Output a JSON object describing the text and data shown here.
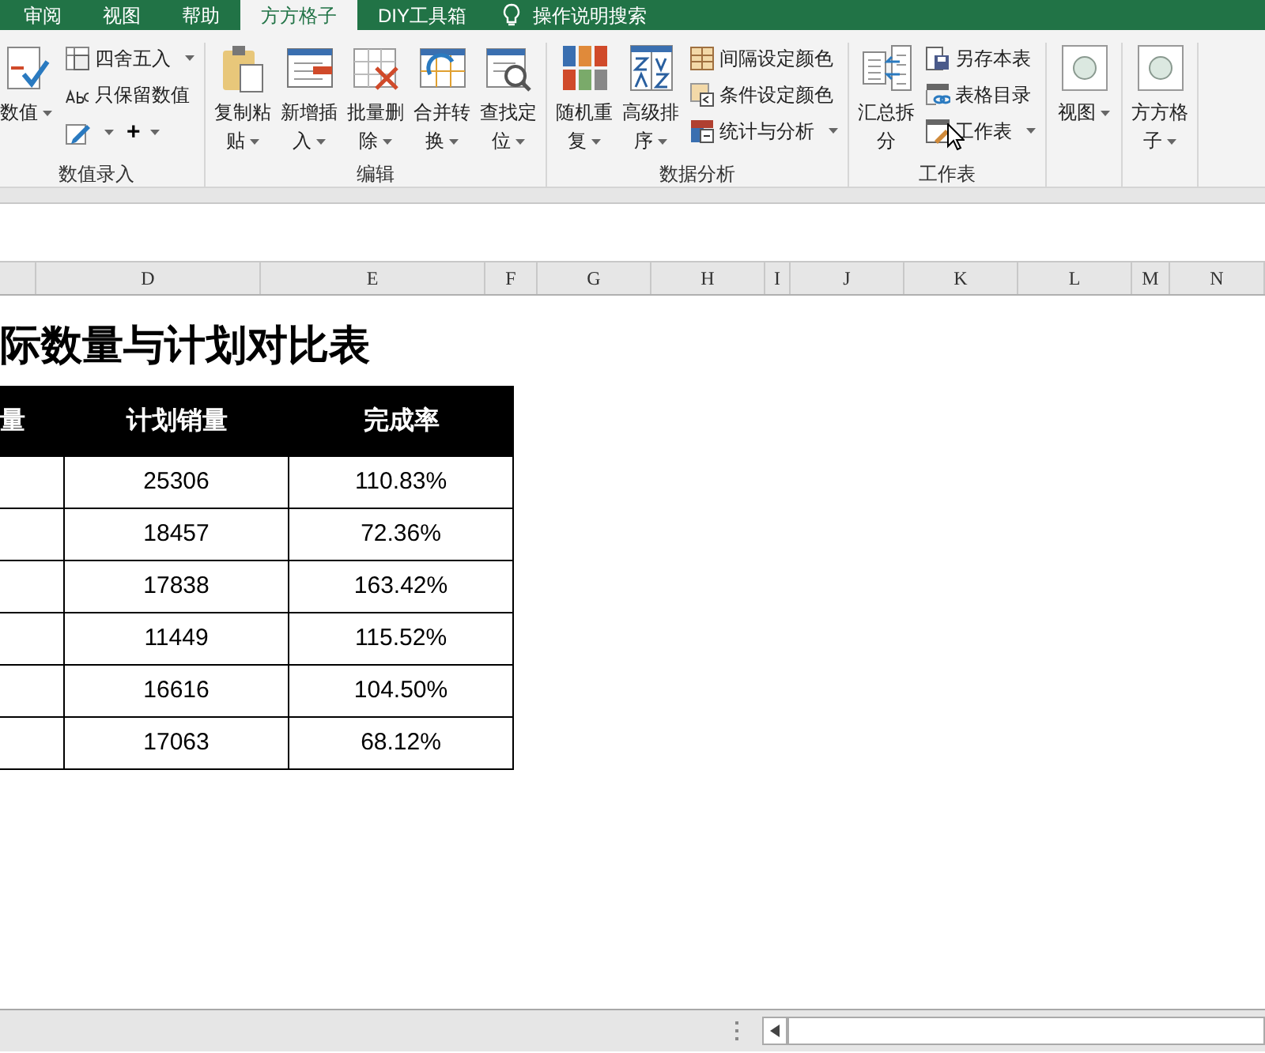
{
  "tabs": [
    {
      "label": "审阅",
      "selected": false
    },
    {
      "label": "视图",
      "selected": false
    },
    {
      "label": "帮助",
      "selected": false
    },
    {
      "label": "方方格子",
      "selected": true
    },
    {
      "label": "DIY工具箱",
      "selected": false
    }
  ],
  "search": {
    "label": "操作说明搜索"
  },
  "ribbon": {
    "groups": [
      {
        "label": "数值录入",
        "items": [
          {
            "kind": "large",
            "label": "数值",
            "dropdown": true
          },
          {
            "kind": "stack",
            "items": [
              {
                "label": "四舍五入",
                "dropdown": true
              },
              {
                "label": "只保留数值",
                "dropdown": false
              },
              {
                "dropdown": true,
                "extra": "+"
              }
            ]
          }
        ]
      },
      {
        "label": "编辑",
        "items": [
          {
            "kind": "large",
            "label": "复制粘贴",
            "dropdown": true
          },
          {
            "kind": "large",
            "label": "新增插入",
            "dropdown": true
          },
          {
            "kind": "large",
            "label": "批量删除",
            "dropdown": true
          },
          {
            "kind": "large",
            "label": "合并转换",
            "dropdown": true
          },
          {
            "kind": "large",
            "label": "查找定位",
            "dropdown": true
          }
        ]
      },
      {
        "label": "数据分析",
        "items": [
          {
            "kind": "large",
            "label": "随机重复",
            "dropdown": true
          },
          {
            "kind": "large",
            "label": "高级排序",
            "dropdown": true
          },
          {
            "kind": "stack",
            "items": [
              {
                "label": "间隔设定颜色",
                "dropdown": false
              },
              {
                "label": "条件设定颜色",
                "dropdown": false
              },
              {
                "label": "统计与分析",
                "dropdown": true
              }
            ]
          }
        ]
      },
      {
        "label": "工作表",
        "items": [
          {
            "kind": "large",
            "label": "汇总拆分",
            "dropdown": false
          },
          {
            "kind": "stack",
            "items": [
              {
                "label": "另存本表",
                "dropdown": false
              },
              {
                "label": "表格目录",
                "dropdown": false
              },
              {
                "label": "工作表",
                "dropdown": true
              }
            ]
          }
        ]
      },
      {
        "items": [
          {
            "kind": "large",
            "label": "视图",
            "dropdown": true
          }
        ]
      },
      {
        "items": [
          {
            "kind": "large",
            "label": "方方格子",
            "dropdown": true
          }
        ]
      }
    ]
  },
  "columns": [
    "D",
    "E",
    "F",
    "G",
    "H",
    "I",
    "J",
    "K",
    "L",
    "M",
    "N"
  ],
  "sheet": {
    "title": "际数量与计划对比表",
    "table": {
      "columns": [
        "量",
        "计划销量",
        "完成率"
      ],
      "rows": [
        {
          "plan": "25306",
          "rate": "110.83%"
        },
        {
          "plan": "18457",
          "rate": "72.36%"
        },
        {
          "plan": "17838",
          "rate": "163.42%"
        },
        {
          "plan": "11449",
          "rate": "115.52%"
        },
        {
          "plan": "16616",
          "rate": "104.50%"
        },
        {
          "plan": "17063",
          "rate": "68.12%"
        }
      ]
    }
  }
}
